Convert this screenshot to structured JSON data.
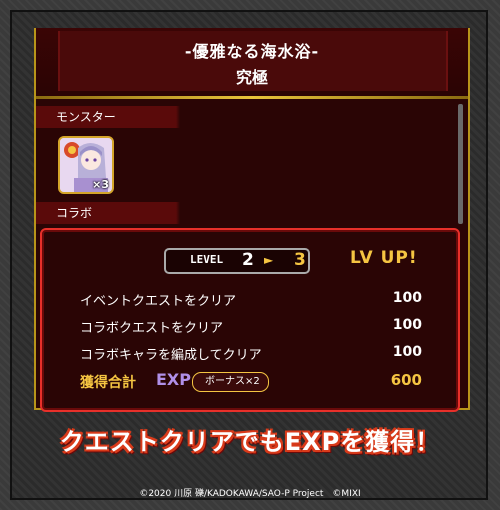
{
  "quest": {
    "title": "-優雅なる海水浴-",
    "difficulty": "究極"
  },
  "sections": {
    "monster_label": "モンスター",
    "monster_count": "×3",
    "collab_label": "コラボ"
  },
  "level": {
    "label": "LEVEL",
    "from": "2",
    "arrow": "►",
    "to": "3",
    "levelup": "LV UP!"
  },
  "rewards": [
    {
      "label": "イベントクエストをクリア",
      "value": "100"
    },
    {
      "label": "コラボクエストをクリア",
      "value": "100"
    },
    {
      "label": "コラボキャラを編成してクリア",
      "value": "100"
    }
  ],
  "total": {
    "label": "獲得合計",
    "exp": "EXP",
    "bonus": "ボーナス×2",
    "value": "600"
  },
  "banner": "クエストクリアでもEXPを獲得！",
  "copyright": "©2020 川原 礫/KADOKAWA/SAO-P Project　©MIXI",
  "colors": {
    "gold": "#f5c542",
    "panel": "#2a0505",
    "border_red": "#e8302a",
    "exp_purple": "#b090e8"
  }
}
